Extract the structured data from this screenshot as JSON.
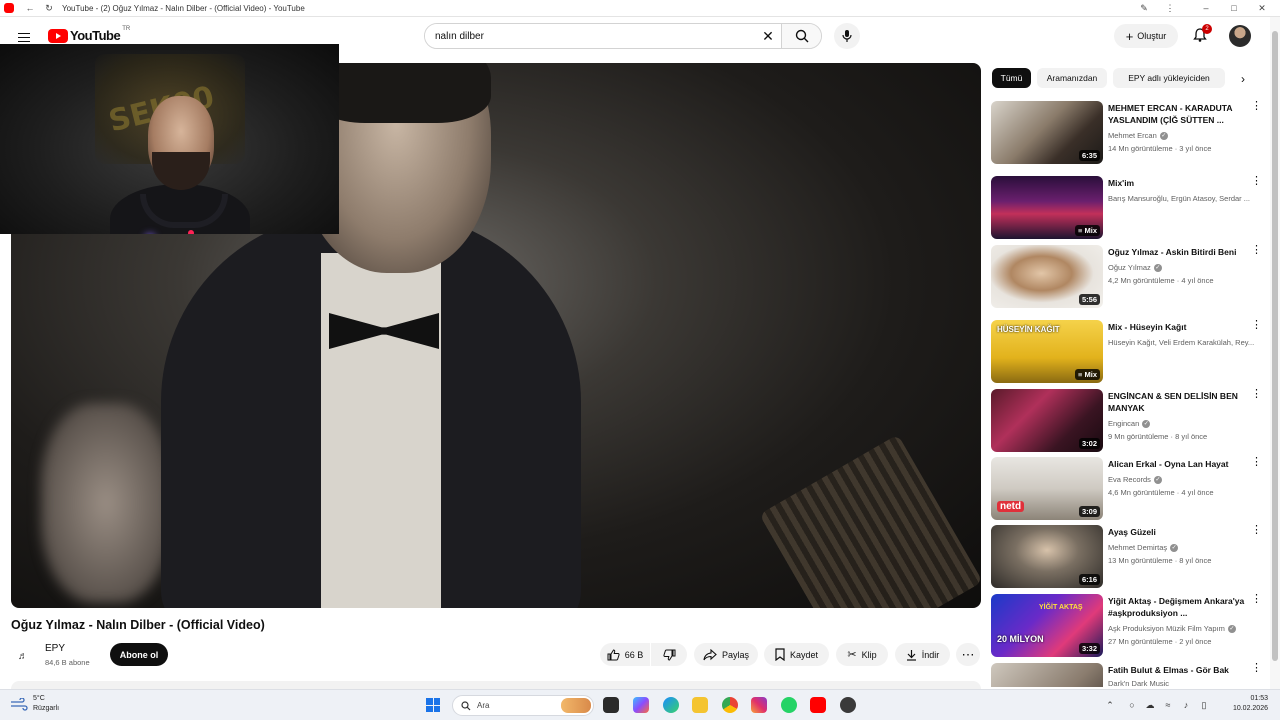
{
  "browser": {
    "tab_title": "YouTube - (2) Oğuz Yılmaz - Nalın Dilber - (Official Video) - YouTube"
  },
  "masthead": {
    "logo_text": "YouTube",
    "region": "TR",
    "search": {
      "value": "nalın dilber",
      "placeholder": "Ara"
    },
    "create_label": "Oluştur",
    "notification_count": "2"
  },
  "webcam": {
    "wall_text": "SEK00"
  },
  "video": {
    "title": "Oğuz Yılmaz - Nalın Dilber - (Official Video)",
    "channel_name": "EPY",
    "channel_subs": "84,6 B abone",
    "subscribe_label": "Abone ol",
    "like_count": "66 B",
    "share_label": "Paylaş",
    "save_label": "Kaydet",
    "clip_label": "Klip",
    "download_label": "İndir"
  },
  "chips": [
    "Tümü",
    "Aramanızdan",
    "EPY adlı yükleyiciden"
  ],
  "recommendations": [
    {
      "title": "MEHMET ERCAN - KARADUTA YASLANDIM (ÇİĞ SÜTTEN ...",
      "channel": "Mehmet Ercan",
      "verified": true,
      "views": "14 Mn görüntüleme",
      "age": "3 yıl önce",
      "duration": "6:35",
      "is_mix": false
    },
    {
      "title": "Mix'im",
      "channel": "Barış Mansuroğlu, Ergün Atasoy, Serdar ...",
      "verified": false,
      "views": "",
      "age": "",
      "duration": "Mix",
      "is_mix": true
    },
    {
      "title": "Oğuz Yılmaz - Askin Bitirdi Beni",
      "channel": "Oğuz Yılmaz",
      "verified": true,
      "views": "4,2 Mn görüntüleme",
      "age": "4 yıl önce",
      "duration": "5:56",
      "is_mix": false
    },
    {
      "title": "Mix - Hüseyin Kağıt",
      "channel": "Hüseyin Kağıt, Veli Erdem Karakülah, Rey...",
      "verified": false,
      "views": "",
      "age": "",
      "duration": "Mix",
      "is_mix": true
    },
    {
      "title": "ENGİNCAN & SEN DELİSİN BEN MANYAK",
      "channel": "Engincan",
      "verified": true,
      "views": "9 Mn görüntüleme",
      "age": "8 yıl önce",
      "duration": "3:02",
      "is_mix": false
    },
    {
      "title": "Alican Erkal - Oyna Lan Hayat",
      "channel": "Eva Records",
      "verified": true,
      "views": "4,6 Mn görüntüleme",
      "age": "4 yıl önce",
      "duration": "3:09",
      "is_mix": false
    },
    {
      "title": "Ayaş Güzeli",
      "channel": "Mehmet Demirtaş",
      "verified": true,
      "views": "13 Mn görüntüleme",
      "age": "8 yıl önce",
      "duration": "6:16",
      "is_mix": false
    },
    {
      "title": "Yiğit Aktaş - Değişmem Ankara'ya #aşkproduksiyon ...",
      "channel": "Aşk Produksiyon Müzik Film Yapım",
      "verified": true,
      "views": "27 Mn görüntüleme",
      "age": "2 yıl önce",
      "duration": "3:32",
      "is_mix": false
    },
    {
      "title": "Fatih Bulut & Elmas - Gör Bak",
      "channel": "Dark'n Dark Music",
      "verified": false,
      "views": "",
      "age": "",
      "duration": "",
      "is_mix": false
    }
  ],
  "thumb_texts": {
    "huseyin": "HÜSEYİN KAĞIT",
    "netd": "netd",
    "yigit": "YİĞİT AKTAŞ",
    "milyon": "20 MİLYON"
  },
  "taskbar": {
    "weather_temp": "5°C",
    "weather_desc": "Rüzgarlı",
    "search_placeholder": "Ara",
    "time": "01:53",
    "date": "10.02.2026"
  },
  "colors": {
    "youtube_red": "#ff0000",
    "text_primary": "#0f0f0f",
    "text_secondary": "#606060",
    "chip_bg": "#f2f2f2"
  }
}
